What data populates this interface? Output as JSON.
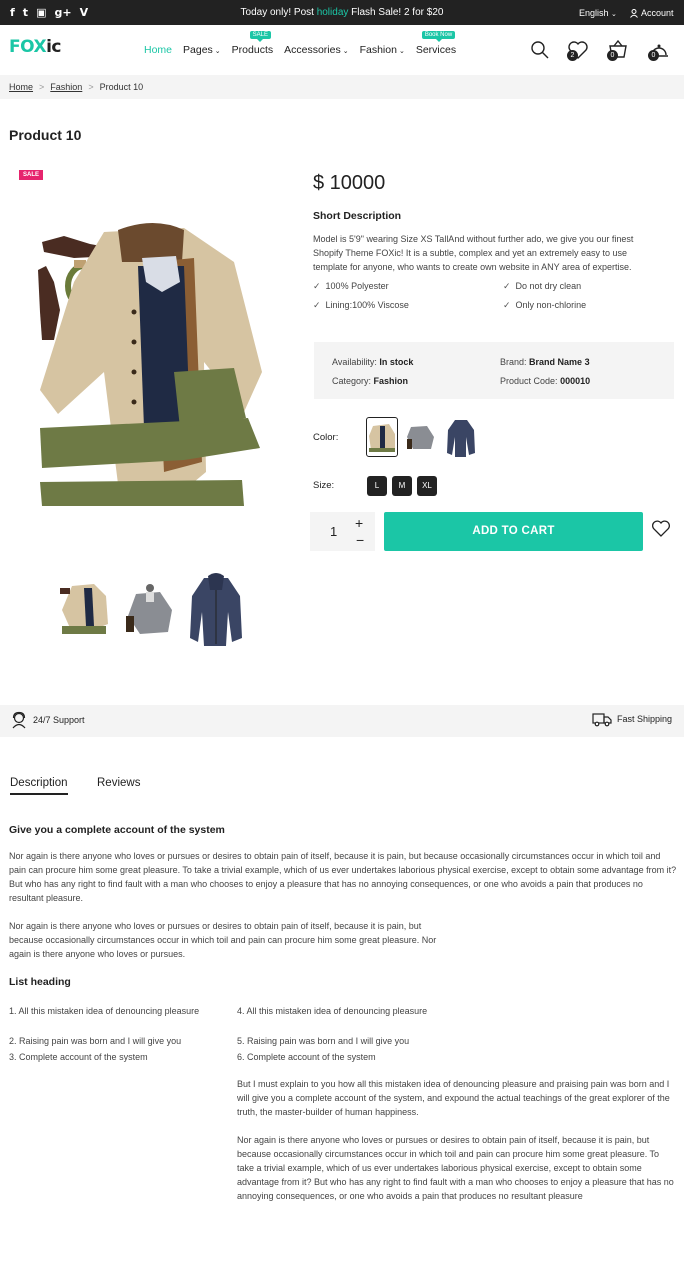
{
  "topbar": {
    "social_icons": [
      "facebook-icon",
      "twitter-icon",
      "instagram-icon",
      "google-plus-icon",
      "vimeo-icon"
    ],
    "social_glyphs": [
      "f",
      "t",
      "▣",
      "g+",
      "V"
    ],
    "promo_before": "Today only! Post ",
    "promo_highlight": "holiday",
    "promo_after": " Flash Sale! 2 for $20",
    "language": "English",
    "account": "Account"
  },
  "header": {
    "logo_part1": "FOX",
    "logo_part2": "ic",
    "nav": [
      {
        "label": "Home",
        "dropdown": false
      },
      {
        "label": "Pages",
        "dropdown": true
      },
      {
        "label": "Products",
        "dropdown": false,
        "badge": "SALE"
      },
      {
        "label": "Accessories",
        "dropdown": true
      },
      {
        "label": "Fashion",
        "dropdown": true
      },
      {
        "label": "Services",
        "dropdown": false,
        "badge": "Book Now"
      }
    ],
    "wishlist_count": "2",
    "cart_count": "0",
    "compare_count": "0"
  },
  "breadcrumb": {
    "items": [
      "Home",
      "Fashion",
      "Product 10"
    ],
    "separator": ">"
  },
  "product": {
    "title": "Product 10",
    "sale_label": "SALE",
    "price": "$ 10000",
    "short_desc_title": "Short Description",
    "short_desc_text": "Model is 5'9\" wearing Size XS TallAnd without further ado, we give you our finest Shopify Theme FOXic! It is a subtle, complex and yet an extremely easy to use template for anyone, who wants to create own website in ANY area of expertise.",
    "features": [
      "100% Polyester",
      "Do not dry clean",
      "Lining:100% Viscose",
      "Only non-chlorine"
    ],
    "availability_label": "Availability:",
    "availability_value": "In stock",
    "brand_label": "Brand:",
    "brand_value": "Brand Name 3",
    "category_label": "Category:",
    "category_value": "Fashion",
    "code_label": "Product Code:",
    "code_value": "000010",
    "color_label": "Color:",
    "size_label": "Size:",
    "sizes": [
      "L",
      "M",
      "XL"
    ],
    "quantity": "1",
    "add_to_cart": "ADD TO CART"
  },
  "services": {
    "support": "24/7 Support",
    "shipping": "Fast Shipping"
  },
  "tabs": [
    "Description",
    "Reviews"
  ],
  "description": {
    "heading": "Give you a complete account of the system",
    "para1": "Nor again is there anyone who loves or pursues or desires to obtain pain of itself, because it is pain, but because occasionally circumstances occur in which toil and pain can procure him some great pleasure. To take a trivial example, which of us ever undertakes laborious physical exercise, except to obtain some advantage from it? But who has any right to find fault with a man who chooses to enjoy a pleasure that has no annoying consequences, or one who avoids a pain that produces no resultant pleasure.",
    "para2": "Nor again is there anyone who loves or pursues or desires to obtain pain of itself, because it is pain, but because occasionally circumstances occur in which toil and pain can procure him some great pleasure. Nor again is there anyone who loves or pursues.",
    "list_heading": "List heading",
    "list_left": [
      "1. All this mistaken idea of denouncing pleasure",
      "2. Raising pain was born and I will give you",
      "3. Complete account of the system"
    ],
    "list_right": [
      "4. All this mistaken idea of denouncing pleasure",
      "5. Raising pain was born and I will give you",
      "6. Complete account of the system"
    ],
    "para3": "But I must explain to you how all this mistaken idea of denouncing pleasure and praising pain was born and I will give you a complete account of the system, and expound the actual teachings of the great explorer of the truth, the master-builder of human happiness.",
    "para4": "Nor again is there anyone who loves or pursues or desires to obtain pain of itself, because it is pain, but because occasionally circumstances occur in which toil and pain can procure him some great pleasure. To take a trivial example, which of us ever undertakes laborious physical exercise, except to obtain some advantage from it? But who has any right to find fault with a man who chooses to enjoy a pleasure that has no annoying consequences, or one who avoids a pain that produces no resultant pleasure"
  },
  "colors": {
    "accent": "#1bc6a6",
    "sale": "#e6246d",
    "dark": "#222222",
    "light_bg": "#f4f4f4"
  }
}
